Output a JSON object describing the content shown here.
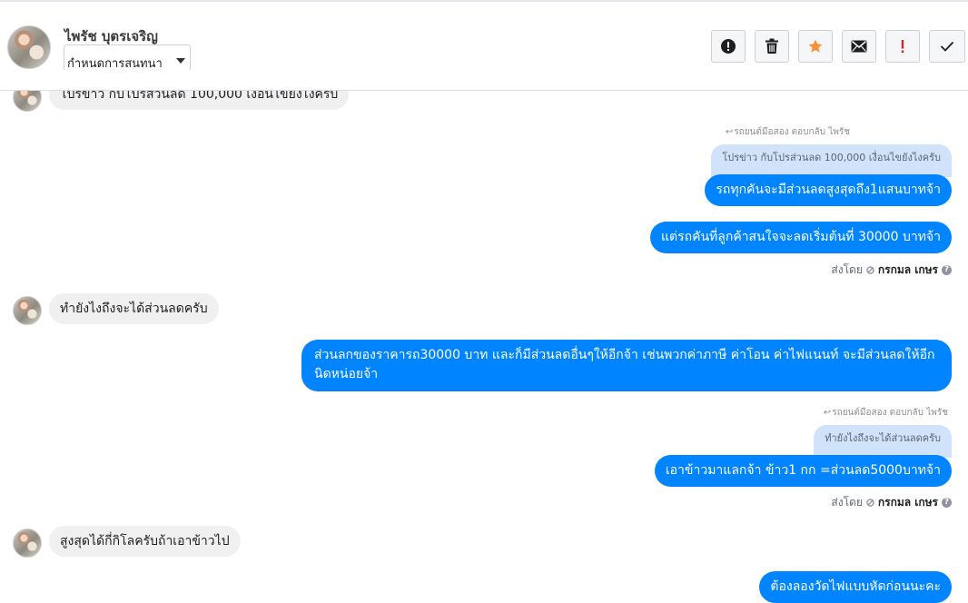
{
  "header": {
    "contact_name": "ไพรัช บุตรเจริญ",
    "assign_label": "กำหนดการสนทนา",
    "actions": [
      {
        "icon": "exclamation-circle-icon",
        "name": "report-spam-button"
      },
      {
        "icon": "trash-icon",
        "name": "delete-button"
      },
      {
        "icon": "star-icon",
        "name": "star-button",
        "color": "#f7923a"
      },
      {
        "icon": "envelope-icon",
        "name": "mark-unread-button"
      },
      {
        "icon": "exclamation-icon",
        "name": "follow-up-button",
        "color": "#e02424"
      },
      {
        "icon": "check-icon",
        "name": "mark-done-button"
      }
    ]
  },
  "messages": {
    "m1": "โปรข่าว กับโปรส่วนลด 100,000 เงื่อนไขยังไงครับ",
    "reply1_meta": "รถยนต์มือสอง ตอบกลับ ไพรัช",
    "reply1_quote": "โปรข่าว กับโปรส่วนลด 100,000 เงื่อนไขยังไงครับ",
    "m2": "รถทุกคันจะมีส่วนลดสูงสุดถึง1แสนบาทจ้า",
    "m3": "แต่รถคันที่ลูกค้าสนใจจะลดเริ่มต้นที่ 30000 บาทจ้า",
    "sentby1_prefix": "ส่งโดย",
    "sentby1_name": "กรกมล เกษร",
    "m4": "ทำยังไงถึงจะได้ส่วนลดครับ",
    "m5": "ส่วนลกของราคารถ30000 บาท และก็มีส่วนลดอื่นๆให้อีกจ้า เช่นพวกค่าภาษี ค่าโอน ค่าไฟแนนท์ จะมีส่วนลดให้อีกนิดหน่อยจ้า",
    "reply2_meta": "รถยนต์มือสอง ตอบกลับ ไพรัช",
    "reply2_quote": "ทำยังไงถึงจะได้ส่วนลดครับ",
    "m6": "เอาข้าวมาแลกจ้า ข้าว1 กก =ส่วนลด5000บาทจ้า",
    "sentby2_prefix": "ส่งโดย",
    "sentby2_name": "กรกมล เกษร",
    "m7": "สูงสุดได้กี่กิโลครับถ้าเอาข้าวไป",
    "m8": "ต้องลองวัดไฟแบบหัดก่อนนะคะ"
  },
  "colors": {
    "outgoing_bubble": "#0084ff",
    "incoming_bubble": "#f1f0f0",
    "quote_bubble": "#d0e3fb"
  }
}
